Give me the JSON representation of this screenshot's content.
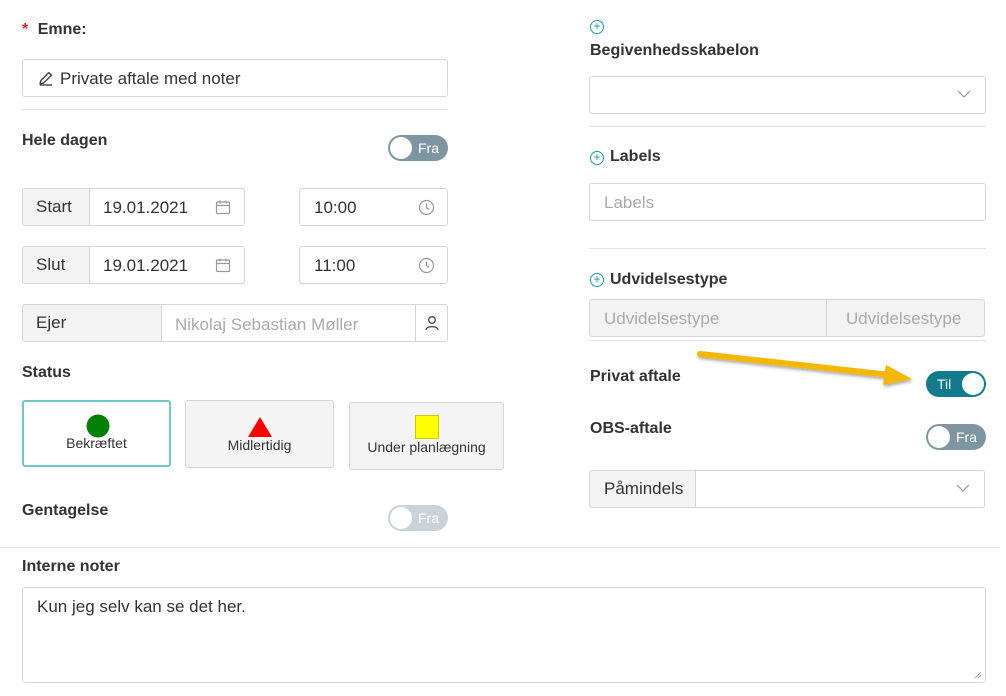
{
  "emne": {
    "label": "Emne",
    "value": "Private aftale med noter",
    "required_mark": "*"
  },
  "hele_dagen": {
    "label": "Hele dagen",
    "toggle_text": "Fra"
  },
  "start": {
    "label": "Start",
    "date": "19.01.2021",
    "time": "10:00"
  },
  "slut": {
    "label": "Slut",
    "date": "19.01.2021",
    "time": "11:00"
  },
  "ejer": {
    "label": "Ejer",
    "placeholder": "Nikolaj Sebastian Møller"
  },
  "status": {
    "label": "Status",
    "options": [
      {
        "label": "Bekræftet",
        "shape": "circle",
        "color": "#008000",
        "selected": true
      },
      {
        "label": "Midlertidig",
        "shape": "triangle",
        "color": "#ff0000"
      },
      {
        "label": "Under planlægning",
        "shape": "square",
        "color": "#ffff00"
      }
    ]
  },
  "gentagelse": {
    "label": "Gentagelse",
    "toggle_text": "Fra"
  },
  "interne_noter": {
    "label": "Interne noter",
    "value": "Kun jeg selv kan se det her."
  },
  "begivenhedsskabelon": {
    "label": "Begivenhedsskabelon"
  },
  "labels": {
    "label": "Labels",
    "placeholder": "Labels"
  },
  "udvidelsestype": {
    "label": "Udvidelsestype",
    "placeholder_left": "Udvidelsestype",
    "placeholder_right": "Udvidelsestype"
  },
  "privat_aftale": {
    "label": "Privat aftale",
    "toggle_text": "Til"
  },
  "obs_aftale": {
    "label": "OBS-aftale",
    "toggle_text": "Fra"
  },
  "paamindelse": {
    "label": "Påmindels"
  },
  "colors": {
    "accent": "#117a8b",
    "arrow": "#f5b800",
    "toggle_off": "#7e95a2",
    "plus": "#1a9aa4"
  }
}
